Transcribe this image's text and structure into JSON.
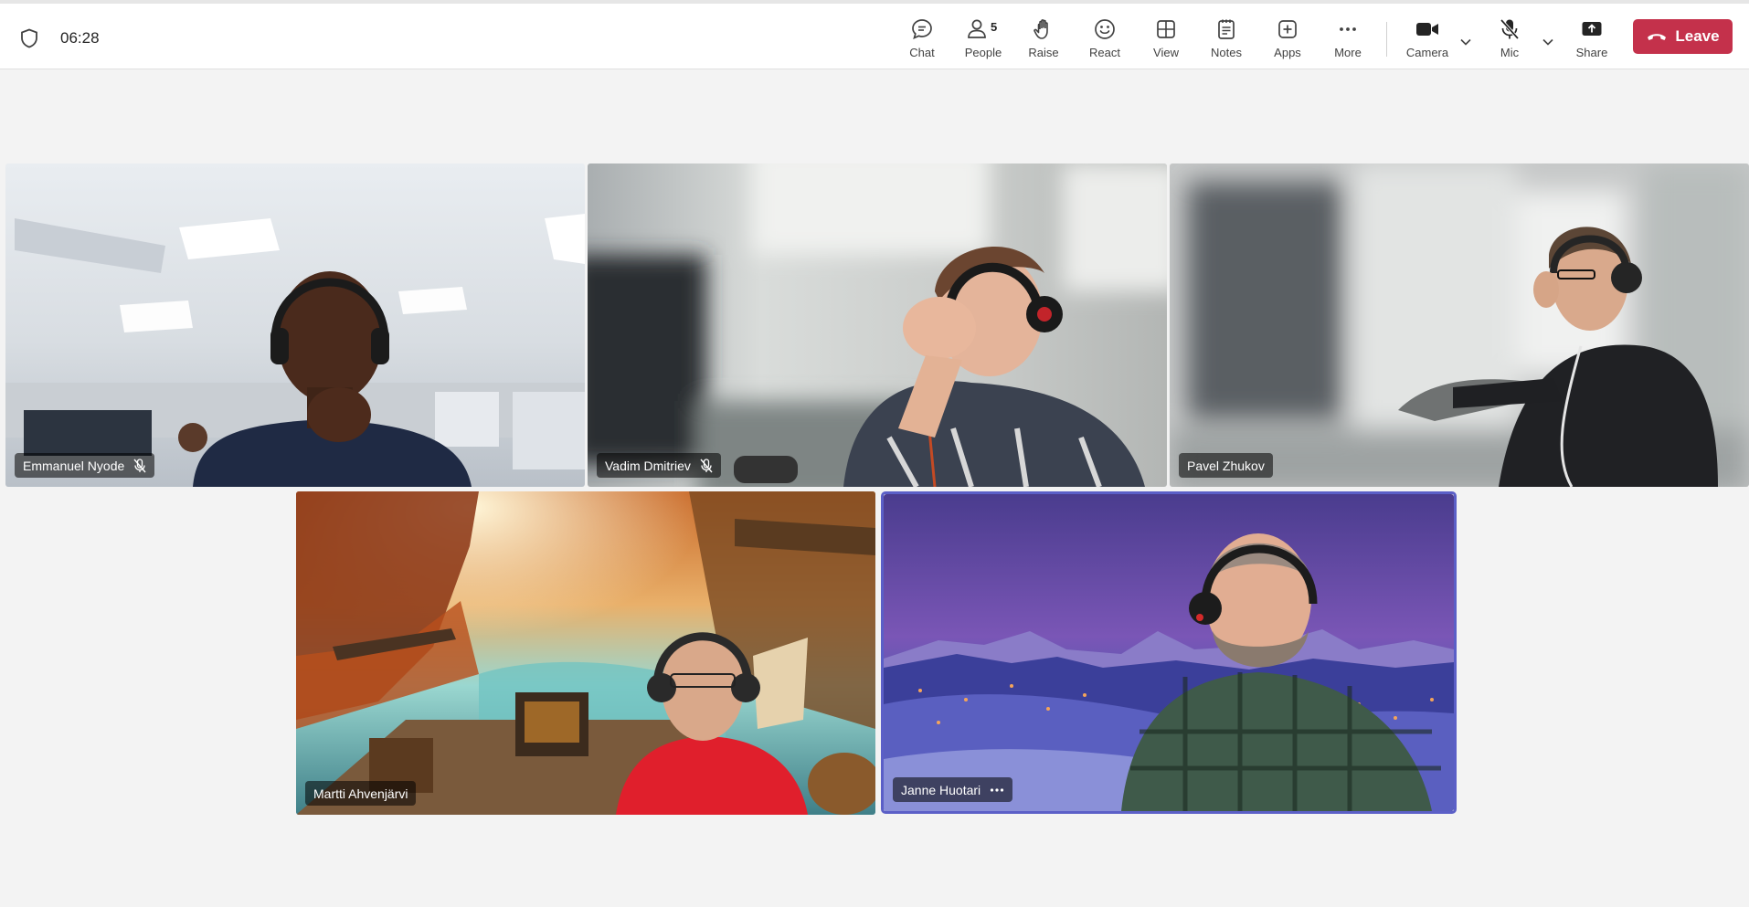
{
  "meeting": {
    "timer": "06:28"
  },
  "toolbar": {
    "chat": "Chat",
    "people": "People",
    "people_count": "5",
    "raise": "Raise",
    "react": "React",
    "view": "View",
    "notes": "Notes",
    "apps": "Apps",
    "more": "More",
    "camera": "Camera",
    "mic": "Mic",
    "share": "Share",
    "leave": "Leave"
  },
  "participants": [
    {
      "name": "Emmanuel Nyode",
      "muted": true
    },
    {
      "name": "Vadim Dmitriev",
      "muted": true
    },
    {
      "name": "Pavel Zhukov",
      "muted": false
    },
    {
      "name": "Martti Ahvenjärvi",
      "muted": false
    },
    {
      "name": "Janne Huotari",
      "muted": false,
      "active_speaker": true
    }
  ],
  "colors": {
    "leave": "#c4314b",
    "active_border": "#5b5fc7",
    "stage_bg": "#f3f3f3"
  }
}
